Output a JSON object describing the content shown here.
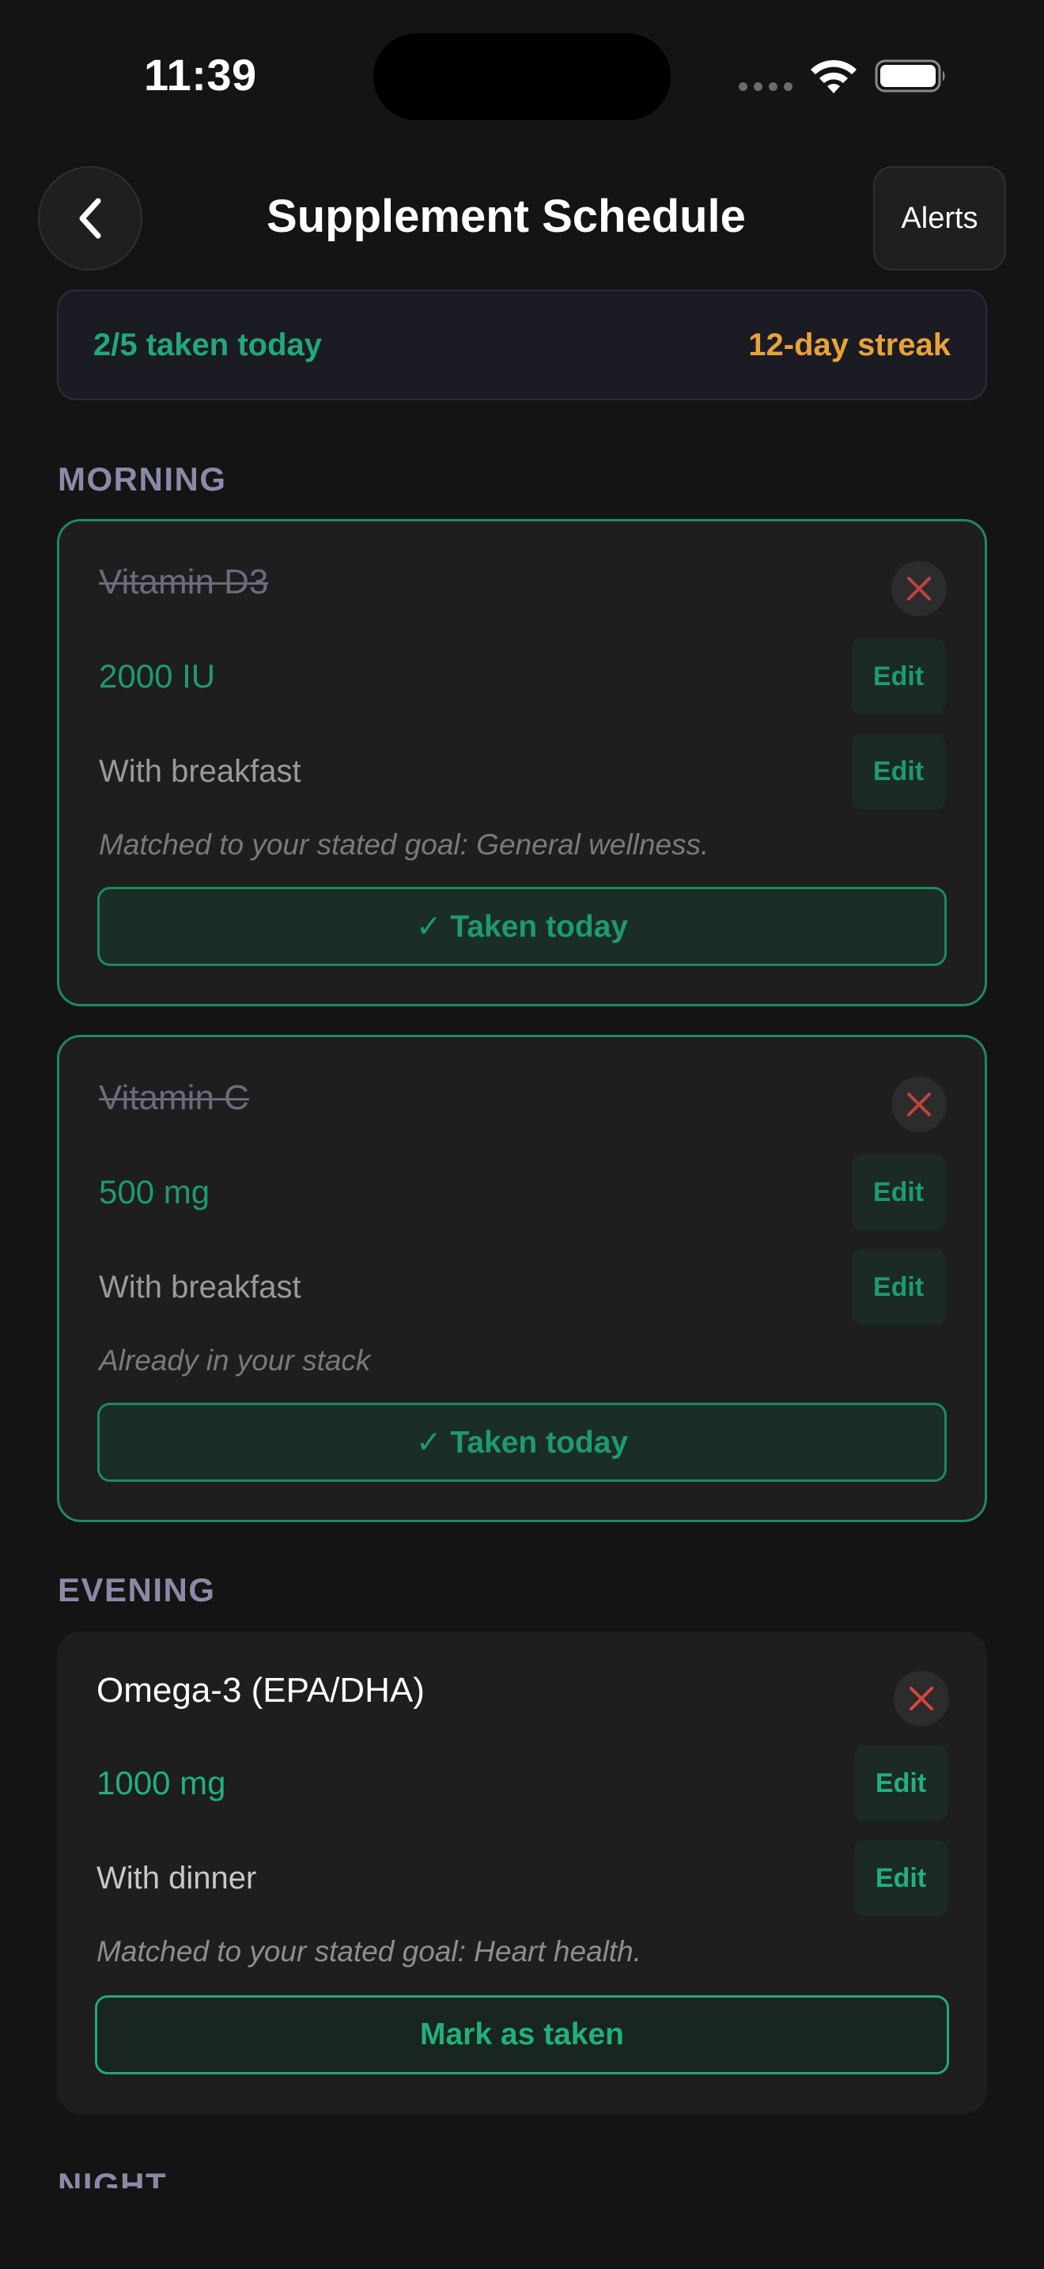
{
  "status_bar": {
    "time": "11:39",
    "icons": [
      "signal-dots-icon",
      "wifi-icon",
      "battery-icon"
    ]
  },
  "header": {
    "back_icon": "chevron-left-icon",
    "title": "Supplement Schedule",
    "alerts_label": "Alerts"
  },
  "summary": {
    "taken_text": "2/5 taken today",
    "streak_text": "12-day streak"
  },
  "colors": {
    "background": "#141414",
    "accent_green": "#22a87a",
    "streak_orange": "#e9a23a",
    "remove_red": "#d9453f",
    "section_label": "#8a8aa8"
  },
  "sections": [
    {
      "label": "MORNING",
      "items": [
        {
          "name": "Vitamin D3",
          "dose": "2000 IU",
          "timing": "With breakfast",
          "note": "Matched to your stated goal: General wellness.",
          "edit_label": "Edit",
          "taken": true,
          "action_label": "✓ Taken today"
        },
        {
          "name": "Vitamin C",
          "dose": "500 mg",
          "timing": "With breakfast",
          "note": "Already in your stack",
          "edit_label": "Edit",
          "taken": true,
          "action_label": "✓ Taken today"
        }
      ]
    },
    {
      "label": "EVENING",
      "items": [
        {
          "name": "Omega-3 (EPA/DHA)",
          "dose": "1000 mg",
          "timing": "With dinner",
          "note": "Matched to your stated goal: Heart health.",
          "edit_label": "Edit",
          "taken": false,
          "action_label": "Mark as taken"
        }
      ]
    },
    {
      "label": "NIGHT",
      "items": []
    }
  ]
}
